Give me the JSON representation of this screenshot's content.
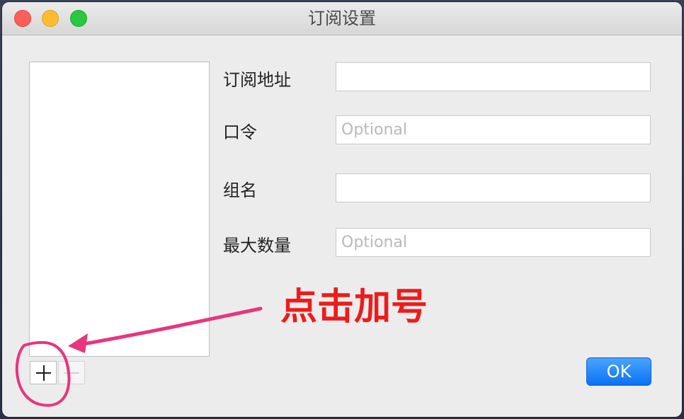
{
  "window": {
    "title": "订阅设置"
  },
  "form": {
    "fields": [
      {
        "label": "订阅地址",
        "value": "",
        "placeholder": ""
      },
      {
        "label": "口令",
        "value": "",
        "placeholder": "Optional"
      },
      {
        "label": "组名",
        "value": "",
        "placeholder": ""
      },
      {
        "label": "最大数量",
        "value": "",
        "placeholder": "Optional"
      }
    ]
  },
  "list": {
    "add_symbol": "+",
    "remove_symbol": "−"
  },
  "buttons": {
    "ok_label": "OK"
  },
  "annotation": {
    "text": "点击加号",
    "color": "#ee1b1b",
    "mark_color": "#e8357f"
  },
  "colors": {
    "accent": "#0a72f3",
    "traffic_close": "#fe5f57",
    "traffic_minimize": "#febc2e",
    "traffic_zoom": "#28c840"
  }
}
